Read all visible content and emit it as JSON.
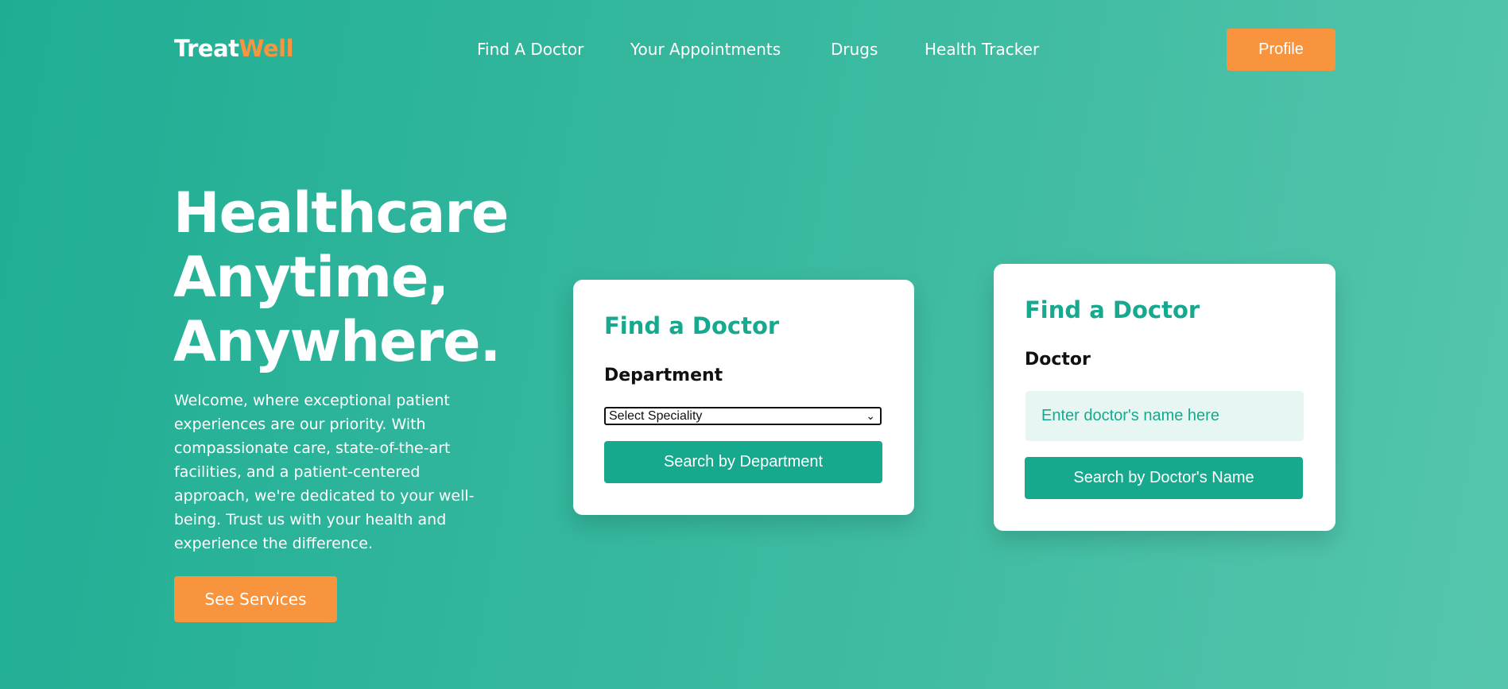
{
  "logo": {
    "part1": "Treat",
    "part2": "Well"
  },
  "nav": {
    "items": [
      "Find A Doctor",
      "Your Appointments",
      "Drugs",
      "Health Tracker"
    ],
    "profile_label": "Profile"
  },
  "hero": {
    "title_lines": [
      "Healthcare",
      "Anytime,",
      "Anywhere."
    ],
    "description": "Welcome, where exceptional patient experiences are our priority. With compassionate care, state-of-the-art facilities, and a patient-centered approach, we're dedicated to your well-being. Trust us with your health and experience the difference.",
    "cta_label": "See Services"
  },
  "department_card": {
    "title": "Find a Doctor",
    "label": "Department",
    "select_value": "Select Speciality",
    "button_label": "Search by Department"
  },
  "doctor_card": {
    "title": "Find a Doctor",
    "label": "Doctor",
    "input_placeholder": "Enter doctor's name here",
    "button_label": "Search by Doctor's Name"
  },
  "colors": {
    "primary": "#16a98d",
    "accent": "#f7943d",
    "background_start": "#1fae94",
    "background_end": "#55c6ad"
  }
}
